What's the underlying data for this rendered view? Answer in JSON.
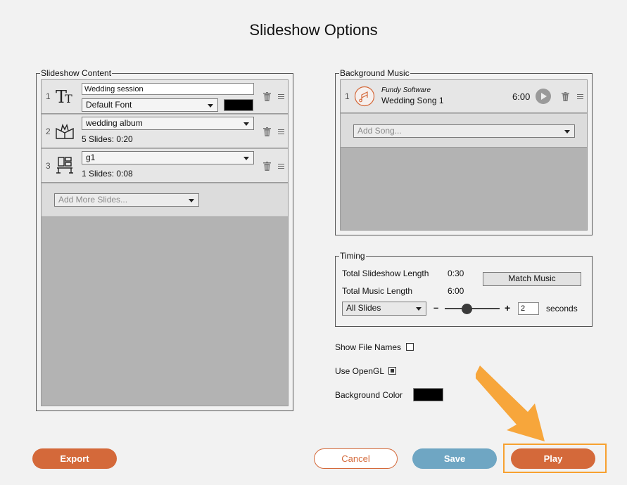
{
  "window": {
    "title": "Slideshow Options"
  },
  "content_panel": {
    "legend": "Slideshow Content",
    "title_slide": {
      "index": "1",
      "title_value": "Wedding session",
      "font_value": "Default Font",
      "color": "#000000"
    },
    "items": [
      {
        "index": "2",
        "name": "wedding album",
        "info": "5 Slides: 0:20"
      },
      {
        "index": "3",
        "name": "g1",
        "info": "1 Slides: 0:08"
      }
    ],
    "add_placeholder": "Add More Slides..."
  },
  "music_panel": {
    "legend": "Background Music",
    "songs": [
      {
        "index": "1",
        "artist": "Fundy Software",
        "title": "Wedding Song 1",
        "duration": "6:00"
      }
    ],
    "add_placeholder": "Add Song..."
  },
  "timing": {
    "legend": "Timing",
    "total_slideshow_label": "Total Slideshow Length",
    "total_slideshow_value": "0:30",
    "total_music_label": "Total Music Length",
    "total_music_value": "6:00",
    "match_music_label": "Match Music",
    "scope_value": "All Slides",
    "minus": "–",
    "plus": "+",
    "seconds_value": "2",
    "seconds_label": "seconds",
    "slider_level": 0.38
  },
  "options": {
    "show_file_names_label": "Show File Names",
    "show_file_names_checked": false,
    "use_opengl_label": "Use OpenGL",
    "use_opengl_checked": true,
    "background_color_label": "Background Color",
    "background_color": "#000000"
  },
  "buttons": {
    "export": "Export",
    "cancel": "Cancel",
    "save": "Save",
    "play": "Play"
  },
  "colors": {
    "accent_orange": "#d4693a",
    "save_blue": "#6fa6c3",
    "highlight": "#f7a130"
  }
}
